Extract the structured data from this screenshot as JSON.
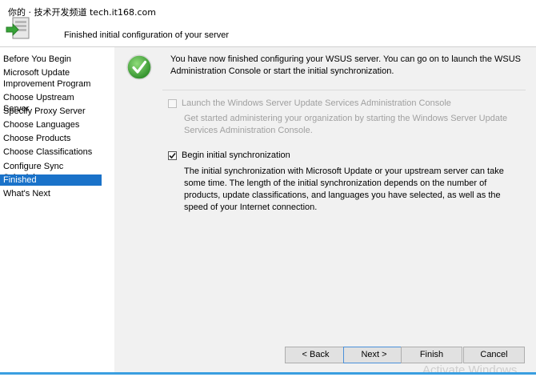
{
  "watermark": "你的 · 技术开发频道 tech.it168.com",
  "header": {
    "title": "Finished initial configuration of your server"
  },
  "nav": {
    "items": [
      {
        "label": "Before You Begin",
        "selected": false
      },
      {
        "label": "Microsoft Update Improvement Program",
        "selected": false
      },
      {
        "label": "Choose Upstream Server",
        "selected": false
      },
      {
        "label": "Specify Proxy Server",
        "selected": false
      },
      {
        "label": "Choose Languages",
        "selected": false
      },
      {
        "label": "Choose Products",
        "selected": false
      },
      {
        "label": "Choose Classifications",
        "selected": false
      },
      {
        "label": "Configure Sync Schedule",
        "selected": false
      },
      {
        "label": "Finished",
        "selected": true
      },
      {
        "label": "What's Next",
        "selected": false
      }
    ]
  },
  "content": {
    "intro": "You have now finished configuring your WSUS server. You can go on to launch the WSUS Administration Console or start the initial synchronization.",
    "option_launch": {
      "label": "Launch the Windows Server Update Services Administration Console",
      "checked": false,
      "enabled": false,
      "description": "Get started administering your organization by starting the Windows Server Update Services Administration Console."
    },
    "option_sync": {
      "label": "Begin initial synchronization",
      "checked": true,
      "enabled": true,
      "description": "The initial synchronization with Microsoft Update or your upstream server can take some time. The length of the initial synchronization depends on the number of products, update classifications, and languages you have selected, as well as the speed of your Internet connection."
    }
  },
  "buttons": {
    "back": "< Back",
    "next": "Next >",
    "finish": "Finish",
    "cancel": "Cancel"
  },
  "activation_watermark": "Activate Windows",
  "colors": {
    "selection": "#1a72c9",
    "content_bg": "#f1f1f1",
    "check_green": "#3fa83a"
  },
  "icons": {
    "header": "wizard-server-icon",
    "status": "green-checkmark-icon"
  }
}
